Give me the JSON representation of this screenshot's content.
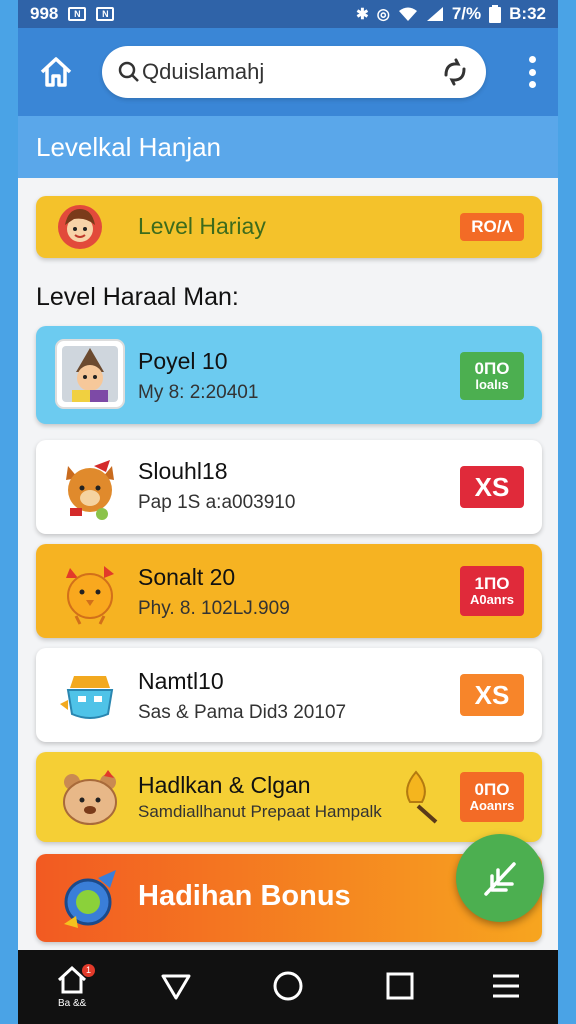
{
  "status_bar": {
    "left_text": "998",
    "right_percent": "7/%",
    "time": "B:32",
    "icons": [
      "notification-icon",
      "notification-icon",
      "bluetooth-icon",
      "sync-icon",
      "wifi-icon",
      "signal-icon",
      "battery-icon"
    ]
  },
  "app_bar": {
    "search_text": "Qduislamahj",
    "icons": [
      "home-icon",
      "search-icon",
      "sync-icon",
      "more-vert-icon"
    ]
  },
  "title_bar": {
    "title": "Levelkal Hanjan"
  },
  "featured": {
    "label": "Level Hariay",
    "badge": "RO/Λ"
  },
  "section_heading": "Level Haraal Man:",
  "items": [
    {
      "name": "Poyel 10",
      "detail": "My 8: 2:20401",
      "badge_line1": "0ΠO",
      "badge_line2": "loalıs",
      "badge_color": "#4caf50",
      "bg": "#6ccbf0",
      "icon": "character-avatar-icon"
    },
    {
      "name": "Slouhl18",
      "detail": "Pap 1S a:a003910",
      "badge_line1": "XS",
      "badge_line2": "",
      "badge_color": "#e02a3a",
      "bg": "#ffffff",
      "icon": "fox-icon"
    },
    {
      "name": "Sonalt 20",
      "detail": "Phy. 8. 102LJ.909",
      "badge_line1": "1ΠO",
      "badge_line2": "A0anrs",
      "badge_color": "#e02a3a",
      "bg": "#f6b322",
      "icon": "chick-icon"
    },
    {
      "name": "Namtl10",
      "detail": "Sas & Pama Did3 20107",
      "badge_line1": "XS",
      "badge_line2": "",
      "badge_color": "#f7852a",
      "bg": "#ffffff",
      "icon": "robot-icon"
    },
    {
      "name": "Hadlkan & Clgan",
      "detail": "Samdiallhanut Prepaat Hampalk",
      "badge_line1": "0ΠO",
      "badge_line2": "Aoanrs",
      "badge_color": "#f36b26",
      "bg": "#f5cf35",
      "icon": "bear-icon"
    }
  ],
  "bonus": {
    "label": "Hadihan Bonus"
  },
  "nav": {
    "home_badge": "1",
    "home_label": "Ba &&"
  },
  "colors": {
    "appbar": "#3a86d6",
    "titlebar": "#5aa7ea",
    "fab": "#4caf50"
  }
}
